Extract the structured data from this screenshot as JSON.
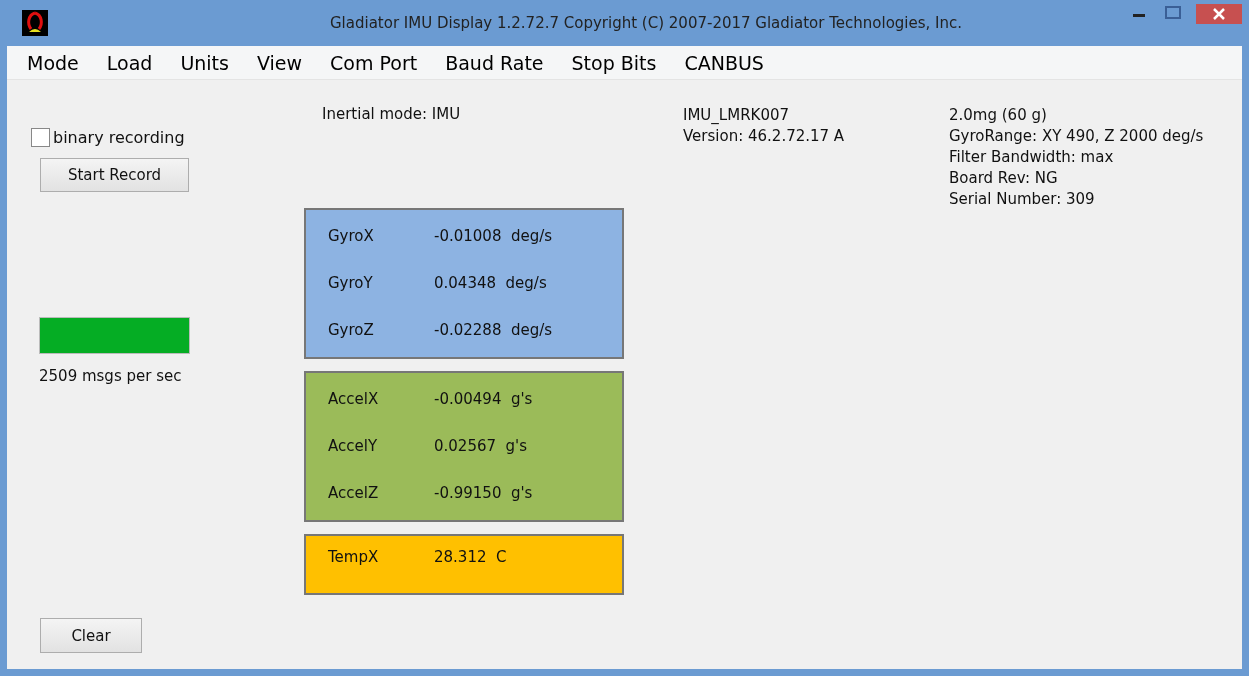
{
  "window": {
    "title": "Gladiator IMU Display 1.2.72.7  Copyright (C) 2007-2017 Gladiator Technologies, Inc."
  },
  "menu": [
    "Mode",
    "Load",
    "Units",
    "View",
    "Com Port",
    "Baud Rate",
    "Stop Bits",
    "CANBUS"
  ],
  "recording": {
    "checkbox": {
      "label": "binary recording",
      "checked": false
    },
    "button": "Start Record"
  },
  "rate": {
    "active": true,
    "text": "2509  msgs per sec"
  },
  "clear_button": "Clear",
  "mode_text": "Inertial mode: IMU",
  "device": [
    "IMU_LMRK007",
    "Version: 46.2.72.17 A"
  ],
  "specs": [
    "2.0mg (60 g)",
    "GyroRange: XY 490, Z 2000 deg/s",
    "Filter Bandwidth: max",
    "Board Rev: NG",
    "Serial Number: 309"
  ],
  "panels": [
    {
      "color": "#8db3e2",
      "rows": [
        {
          "name": "GyroX",
          "value": "-0.01008  deg/s"
        },
        {
          "name": "GyroY",
          "value": "0.04348  deg/s"
        },
        {
          "name": "GyroZ",
          "value": "-0.02288  deg/s"
        }
      ]
    },
    {
      "color": "#9bbb59",
      "rows": [
        {
          "name": "AccelX",
          "value": "-0.00494  g's"
        },
        {
          "name": "AccelY",
          "value": "0.02567  g's"
        },
        {
          "name": "AccelZ",
          "value": "-0.99150  g's"
        }
      ]
    },
    {
      "color": "#ffc000",
      "rows": [
        {
          "name": "TempX",
          "value": "28.312  C"
        }
      ]
    }
  ]
}
